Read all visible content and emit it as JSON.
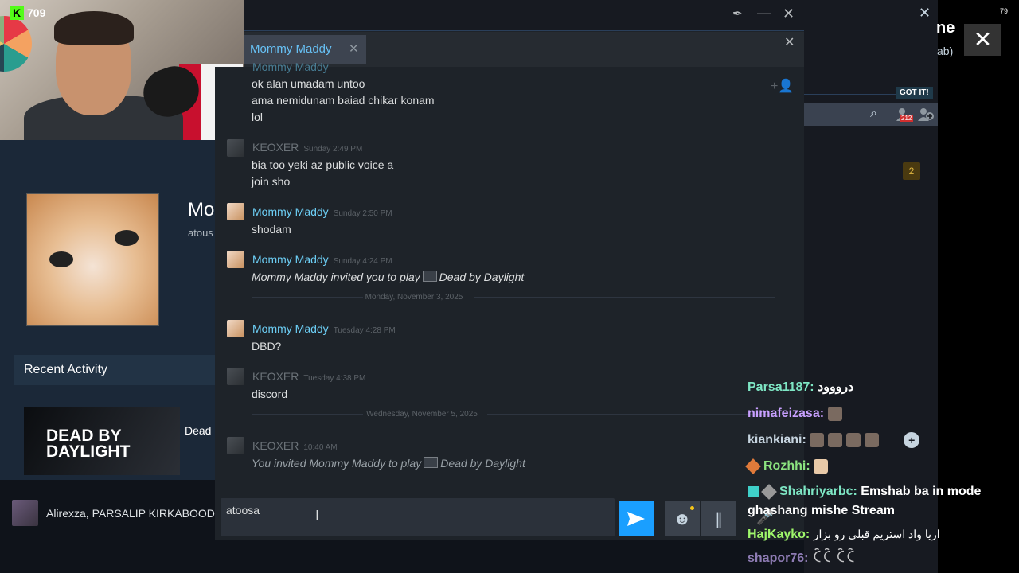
{
  "stream": {
    "viewer_count": "709",
    "corner_count": "79"
  },
  "window": {
    "tab_label": "Mommy Maddy",
    "title_partial": "ne",
    "subtitle_partial": "ab)"
  },
  "profile": {
    "name_partial": "Mo",
    "sub_partial": "atous",
    "recent_activity": "Recent Activity",
    "game_banner": "DEAD BY DAYLIGHT",
    "game_name_partial": "Dead"
  },
  "friends_bar": {
    "names": "Alirexza, PARSALIP KIRKABOOD,"
  },
  "messages": {
    "top_lines": [
      "ok alan umadam untoo",
      "ama nemidunam baiad chikar konam",
      "lol"
    ],
    "top_sender": "Mommy Maddy",
    "m1": {
      "sender": "KEOXER",
      "time": "Sunday 2:49 PM",
      "lines": [
        "bia too yeki az public voice a",
        "join sho"
      ]
    },
    "m2": {
      "sender": "Mommy Maddy",
      "time": "Sunday 2:50 PM",
      "lines": [
        "shodam"
      ]
    },
    "m3": {
      "sender": "Mommy Maddy",
      "time": "Sunday 4:24 PM",
      "invite_prefix": "Mommy Maddy invited you to play",
      "game": "Dead by Daylight"
    },
    "sep1": "Monday, November 3, 2025",
    "m4": {
      "sender": "Mommy Maddy",
      "time": "Tuesday 4:28 PM",
      "lines": [
        "DBD?"
      ]
    },
    "m5": {
      "sender": "KEOXER",
      "time": "Tuesday 4:38 PM",
      "lines": [
        "discord"
      ]
    },
    "sep2": "Wednesday, November 5, 2025",
    "m6": {
      "sender": "KEOXER",
      "time": "10:40 AM",
      "invite_prefix": "You invited Mommy Maddy to play",
      "game": "Dead by Daylight"
    }
  },
  "input": {
    "value": "atoosa"
  },
  "right_panel": {
    "got_it": "GOT IT!",
    "notif_count": "212",
    "badge_count": "2"
  },
  "stream_chat": [
    {
      "user": "Parsa1187:",
      "text": "درووود"
    },
    {
      "user": "nimafeizasa:",
      "text": ""
    },
    {
      "user": "kiankiani:",
      "text": ""
    },
    {
      "user": "Rozhhi:",
      "text": ""
    },
    {
      "user": "Shahriyarbc:",
      "text": "Emshab ba in mode"
    },
    {
      "user": "",
      "text": "ghashang mishe Stream"
    },
    {
      "user": "HajKayko:",
      "text": "اریا واد استریم قبلی رو بزار"
    },
    {
      "user": "shapor76:",
      "text": "ꉓꉓ ꉓꉓ"
    }
  ]
}
